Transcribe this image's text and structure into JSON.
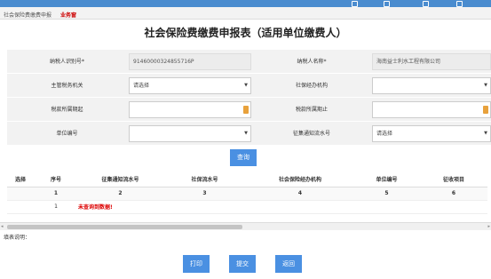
{
  "topbar": {
    "items": [
      "",
      "",
      "",
      ""
    ]
  },
  "breadcrumb": {
    "section": "社会保险费缴费申报",
    "current": "业务窗"
  },
  "page_title": "社会保险费缴费申报表（适用单位缴费人）",
  "form": {
    "taxpayer_id_label": "纳税人识别号*",
    "taxpayer_id_value": "91460000324855716P",
    "taxpayer_name_label": "纳税人名称*",
    "taxpayer_name_value": "海南益士利水工程有限公司",
    "tax_authority_label": "主管税务机关",
    "tax_authority_placeholder": "请选择",
    "agency_label": "社保经办机构",
    "agency_value": "",
    "period_start_label": "税款所属期起",
    "period_end_label": "税款所属期止",
    "unit_code_label": "单位编号",
    "unit_code_value": "",
    "notice_no_label": "征集通知流水号",
    "notice_no_placeholder": "请选择"
  },
  "query_button": "查询",
  "table": {
    "headers": [
      "选择",
      "序号",
      "征集通知流水号",
      "社保流水号",
      "社会保险经办机构",
      "单位编号",
      "征收项目"
    ],
    "index_row": [
      "",
      "1",
      "2",
      "3",
      "4",
      "5",
      "6"
    ],
    "result_row": {
      "seq": "1",
      "message": "未查询到数据!"
    }
  },
  "note_label": "填表说明：",
  "buttons": {
    "print": "打印",
    "submit": "提交",
    "back": "返回"
  },
  "colors": {
    "accent": "#4a90e2",
    "topbar": "#4a8ccf",
    "error": "#d00000",
    "calendar": "#e8a13b"
  }
}
